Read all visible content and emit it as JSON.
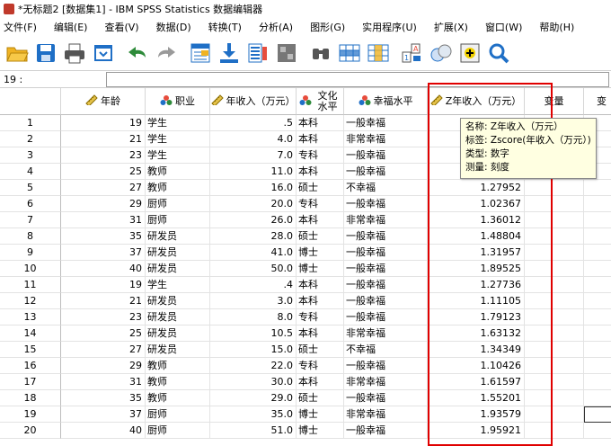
{
  "window": {
    "title": "*无标题2 [数据集1] - IBM SPSS Statistics 数据编辑器"
  },
  "menu": [
    "文件(F)",
    "编辑(E)",
    "查看(V)",
    "数据(D)",
    "转换(T)",
    "分析(A)",
    "图形(G)",
    "实用程序(U)",
    "扩展(X)",
    "窗口(W)",
    "帮助(H)"
  ],
  "toolbar": {
    "icons": [
      "open-folder-icon",
      "save-icon",
      "print-icon",
      "dialog-recall-icon",
      "undo-icon",
      "redo-icon",
      "goto-case-icon",
      "goto-variable-icon",
      "variables-icon",
      "run-descriptives-icon",
      "find-icon",
      "insert-cases-icon",
      "insert-variable-icon",
      "split-file-icon",
      "weight-cases-icon",
      "select-cases-icon",
      "value-labels-icon",
      "use-sets-icon",
      "show-all-variables-icon",
      "spell-check-icon"
    ],
    "colors": {
      "accent_blue": "#1f6fc6",
      "folder": "#f0b323",
      "excel_green": "#2e8b3a"
    }
  },
  "cell_editor": {
    "ref": "19 :",
    "value": ""
  },
  "columns": [
    {
      "name": "年龄",
      "icon": "scale-ruler-icon"
    },
    {
      "name": "职业",
      "icon": "nominal-icon"
    },
    {
      "name": "年收入（万元）",
      "icon": "scale-ruler-icon"
    },
    {
      "name": "文化水平",
      "icon": "nominal-icon"
    },
    {
      "name": "幸福水平",
      "icon": "nominal-icon"
    },
    {
      "name": "Z年收入（万元）",
      "icon": "scale-ruler-icon"
    },
    {
      "name": "变量",
      "icon": ""
    },
    {
      "name": "变",
      "icon": ""
    }
  ],
  "rows": [
    {
      "n": "1",
      "age": "19",
      "job": "学生",
      "income": ".5",
      "edu": "本科",
      "happy": "一般幸福",
      "z": ""
    },
    {
      "n": "2",
      "age": "21",
      "job": "学生",
      "income": "4.0",
      "edu": "本科",
      "happy": "非常幸福",
      "z": ""
    },
    {
      "n": "3",
      "age": "23",
      "job": "学生",
      "income": "7.0",
      "edu": "专科",
      "happy": "一般幸福",
      "z": ""
    },
    {
      "n": "4",
      "age": "25",
      "job": "教师",
      "income": "11.0",
      "edu": "本科",
      "happy": "一般幸福",
      "z": ""
    },
    {
      "n": "5",
      "age": "27",
      "job": "教师",
      "income": "16.0",
      "edu": "硕士",
      "happy": "不幸福",
      "z": "1.27952"
    },
    {
      "n": "6",
      "age": "29",
      "job": "厨师",
      "income": "20.0",
      "edu": "专科",
      "happy": "一般幸福",
      "z": "1.02367"
    },
    {
      "n": "7",
      "age": "31",
      "job": "厨师",
      "income": "26.0",
      "edu": "本科",
      "happy": "非常幸福",
      "z": "1.36012"
    },
    {
      "n": "8",
      "age": "35",
      "job": "研发员",
      "income": "28.0",
      "edu": "硕士",
      "happy": "一般幸福",
      "z": "1.48804"
    },
    {
      "n": "9",
      "age": "37",
      "job": "研发员",
      "income": "41.0",
      "edu": "博士",
      "happy": "一般幸福",
      "z": "1.31957"
    },
    {
      "n": "10",
      "age": "40",
      "job": "研发员",
      "income": "50.0",
      "edu": "博士",
      "happy": "一般幸福",
      "z": "1.89525"
    },
    {
      "n": "11",
      "age": "19",
      "job": "学生",
      "income": ".4",
      "edu": "本科",
      "happy": "一般幸福",
      "z": "1.27736"
    },
    {
      "n": "12",
      "age": "21",
      "job": "研发员",
      "income": "3.0",
      "edu": "本科",
      "happy": "一般幸福",
      "z": "1.11105"
    },
    {
      "n": "13",
      "age": "23",
      "job": "研发员",
      "income": "8.0",
      "edu": "专科",
      "happy": "一般幸福",
      "z": "1.79123"
    },
    {
      "n": "14",
      "age": "25",
      "job": "研发员",
      "income": "10.5",
      "edu": "本科",
      "happy": "非常幸福",
      "z": "1.63132"
    },
    {
      "n": "15",
      "age": "27",
      "job": "研发员",
      "income": "15.0",
      "edu": "硕士",
      "happy": "不幸福",
      "z": "1.34349"
    },
    {
      "n": "16",
      "age": "29",
      "job": "教师",
      "income": "22.0",
      "edu": "专科",
      "happy": "一般幸福",
      "z": "1.10426"
    },
    {
      "n": "17",
      "age": "31",
      "job": "教师",
      "income": "30.0",
      "edu": "本科",
      "happy": "非常幸福",
      "z": "1.61597"
    },
    {
      "n": "18",
      "age": "35",
      "job": "教师",
      "income": "29.0",
      "edu": "硕士",
      "happy": "一般幸福",
      "z": "1.55201"
    },
    {
      "n": "19",
      "age": "37",
      "job": "厨师",
      "income": "35.0",
      "edu": "博士",
      "happy": "非常幸福",
      "z": "1.93579"
    },
    {
      "n": "20",
      "age": "40",
      "job": "厨师",
      "income": "51.0",
      "edu": "博士",
      "happy": "一般幸福",
      "z": "1.95921"
    }
  ],
  "tooltip": {
    "name": "名称: Z年收入（万元）",
    "label": "标签: Zscore(年收入（万元）)",
    "type": "类型: 数字",
    "measure": "测量: 刻度"
  },
  "highlight_color": "#e00000",
  "tooltip_bg": "#ffffe1"
}
